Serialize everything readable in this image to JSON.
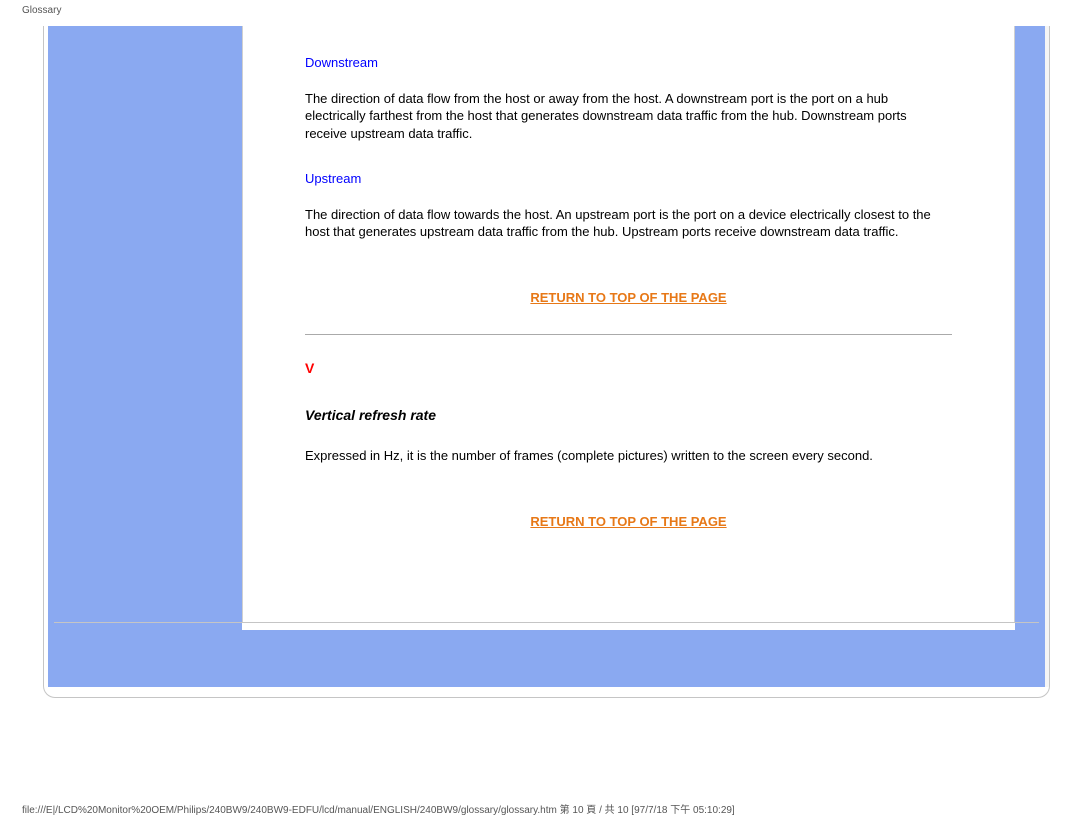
{
  "header_title": "Glossary",
  "entries": {
    "downstream": {
      "title": "Downstream",
      "body": "The direction of data flow from the host or away from the host. A downstream port is the port on a hub electrically farthest from the host that generates downstream data traffic from the hub. Downstream ports receive upstream data traffic."
    },
    "upstream": {
      "title": "Upstream",
      "body": "The direction of data flow towards the host. An upstream port is the port on a device electrically closest to the host that generates upstream data traffic from the hub. Upstream ports receive downstream data traffic."
    },
    "vertical_refresh": {
      "title": "Vertical refresh rate",
      "body": "Expressed in Hz, it is the number of frames (complete pictures) written to the screen every second."
    }
  },
  "section_letter": "V",
  "return_link_text": "RETURN TO TOP OF THE PAGE",
  "footer_path": "file:///E|/LCD%20Monitor%20OEM/Philips/240BW9/240BW9-EDFU/lcd/manual/ENGLISH/240BW9/glossary/glossary.htm 第 10 頁 / 共 10 [97/7/18 下午 05:10:29]"
}
